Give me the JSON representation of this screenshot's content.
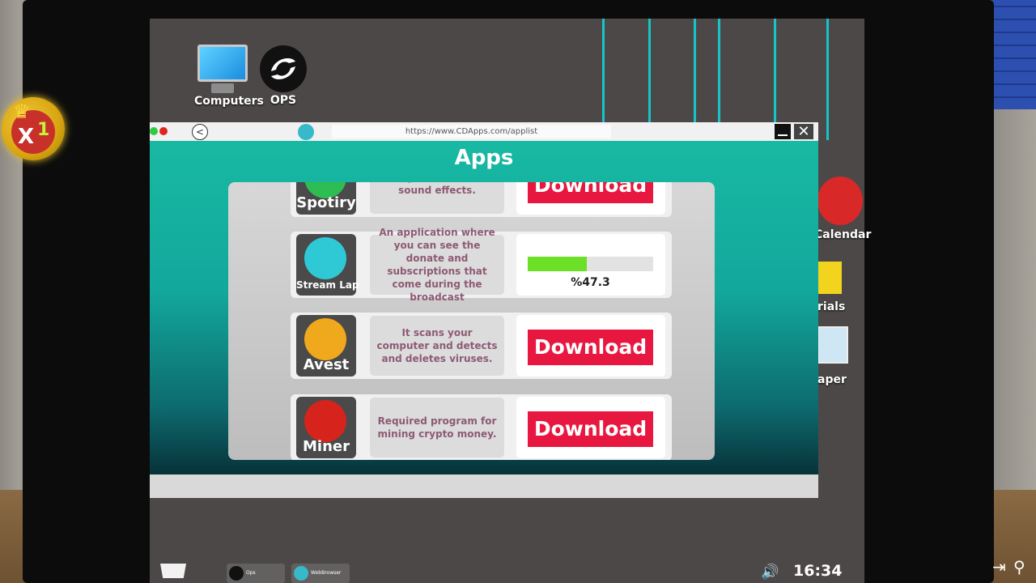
{
  "game": {
    "badge_prefix": "X",
    "badge_count": "1"
  },
  "desktop": {
    "icons": [
      {
        "label": "Computers",
        "icon": "computer-icon"
      },
      {
        "label": "OPS",
        "icon": "ops-logo-icon"
      }
    ],
    "side_icons": [
      {
        "label": "Calendar",
        "icon": "calendar-icon"
      },
      {
        "label": "rials",
        "icon": "folder-icon"
      },
      {
        "label": "aper",
        "icon": "wallpaper-icon"
      }
    ]
  },
  "browser": {
    "url": "https://www.CDApps.com/applist",
    "back_symbol": "<",
    "close_symbol": "✕",
    "page_title": "Apps"
  },
  "apps": [
    {
      "name": "Spotiry",
      "description": "with great music and sound effects.",
      "action": "Download",
      "color": "#2dbd52"
    },
    {
      "name": "Stream Lap",
      "description": "An application where you can see the donate and subscriptions that come during the broadcast",
      "progress": 47.3,
      "progress_label": "%47.3",
      "color": "#2fc9d6"
    },
    {
      "name": "Avest",
      "description": "It scans your computer and detects and deletes viruses.",
      "action": "Download",
      "color": "#f0a81c"
    },
    {
      "name": "Miner",
      "description": "Required program for mining crypto money.",
      "action": "Download",
      "color": "#d6241c"
    }
  ],
  "taskbar": {
    "items": [
      {
        "label": "Ops",
        "icon": "ops-logo-icon"
      },
      {
        "label": "WebBrowser",
        "icon": "globe-icon"
      }
    ],
    "clock": "16:34",
    "volume_symbol": "🔊"
  },
  "colors": {
    "accent": "#e8173f",
    "teal": "#18b9a3",
    "progress": "#6be026"
  }
}
